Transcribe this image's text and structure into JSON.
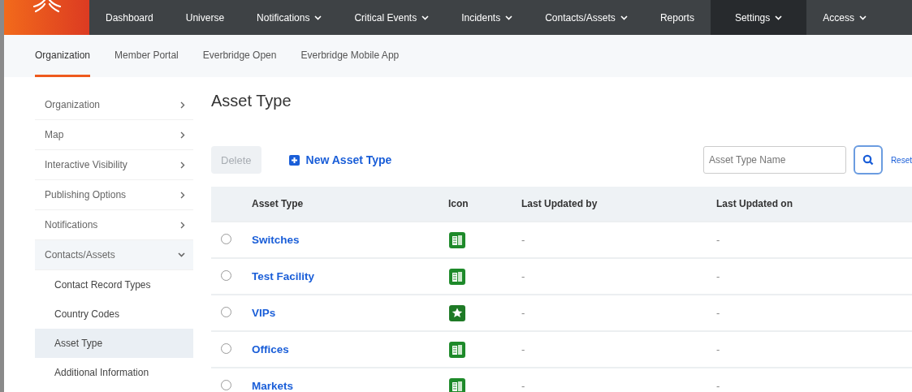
{
  "top_nav": [
    {
      "label": "Dashboard",
      "dropdown": false,
      "selected": false
    },
    {
      "label": "Universe",
      "dropdown": false,
      "selected": false
    },
    {
      "label": "Notifications",
      "dropdown": true,
      "selected": false
    },
    {
      "label": "Critical Events",
      "dropdown": true,
      "selected": false
    },
    {
      "label": "Incidents",
      "dropdown": true,
      "selected": false
    },
    {
      "label": "Contacts/Assets",
      "dropdown": true,
      "selected": false
    },
    {
      "label": "Reports",
      "dropdown": false,
      "selected": false
    },
    {
      "label": "Settings",
      "dropdown": true,
      "selected": true
    },
    {
      "label": "Access",
      "dropdown": true,
      "selected": false
    }
  ],
  "sub_tabs": [
    {
      "label": "Organization",
      "selected": true
    },
    {
      "label": "Member Portal",
      "selected": false
    },
    {
      "label": "Everbridge Open",
      "selected": false
    },
    {
      "label": "Everbridge Mobile App",
      "selected": false
    }
  ],
  "sidebar": {
    "items": [
      {
        "label": "Organization",
        "expanded": false
      },
      {
        "label": "Map",
        "expanded": false
      },
      {
        "label": "Interactive Visibility",
        "expanded": false
      },
      {
        "label": "Publishing Options",
        "expanded": false
      },
      {
        "label": "Notifications",
        "expanded": false
      },
      {
        "label": "Contacts/Assets",
        "expanded": true,
        "children": [
          {
            "label": "Contact Record Types",
            "selected": false
          },
          {
            "label": "Country Codes",
            "selected": false
          },
          {
            "label": "Asset Type",
            "selected": true
          },
          {
            "label": "Additional Information",
            "selected": false
          }
        ]
      }
    ]
  },
  "page_title": "Asset Type",
  "toolbar": {
    "delete_button": {
      "label": "Delete",
      "disabled": true
    },
    "new_button": "New Asset Type",
    "search": {
      "placeholder": "Asset Type Name"
    },
    "reset_link": "Reset"
  },
  "table": {
    "columns": [
      "Asset Type",
      "Icon",
      "Last Updated by",
      "Last Updated on"
    ],
    "rows": [
      {
        "selected": false,
        "name": "Switches",
        "kind": "building",
        "updated_by": "-",
        "updated_on": "-"
      },
      {
        "selected": false,
        "name": "Test Facility",
        "kind": "building",
        "updated_by": "-",
        "updated_on": "-"
      },
      {
        "selected": false,
        "name": "VIPs",
        "kind": "star",
        "updated_by": "-",
        "updated_on": "-"
      },
      {
        "selected": false,
        "name": "Offices",
        "kind": "building",
        "updated_by": "-",
        "updated_on": "-"
      },
      {
        "selected": false,
        "name": "Markets",
        "kind": "building",
        "updated_by": "-",
        "updated_on": "-"
      }
    ]
  }
}
